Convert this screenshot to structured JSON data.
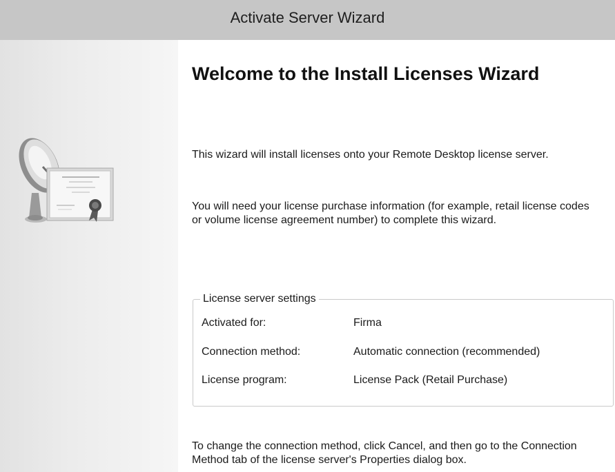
{
  "window": {
    "title": "Activate Server Wizard"
  },
  "sidebar": {
    "graphic_icon": "satellite-dish-certificate-icon"
  },
  "main": {
    "heading": "Welcome to the Install Licenses Wizard",
    "intro": "This wizard will install licenses onto your Remote Desktop license server.",
    "requirements": "You will need your license purchase information (for example, retail license codes or volume license agreement number) to complete this wizard.",
    "settings": {
      "legend": "License server settings",
      "rows": [
        {
          "label": "Activated for:",
          "value": "Firma"
        },
        {
          "label": "Connection method:",
          "value": "Automatic connection (recommended)"
        },
        {
          "label": "License program:",
          "value": "License Pack (Retail Purchase)"
        }
      ]
    },
    "footer_note": "To change the connection method, click Cancel, and then go to the Connection Method tab of the license server's Properties dialog box."
  },
  "colors": {
    "titlebar_bg": "#c6c6c6",
    "sidebar_bg": "#e6e6e6",
    "content_bg": "#ffffff",
    "groupbox_border": "#c9c9c9"
  }
}
